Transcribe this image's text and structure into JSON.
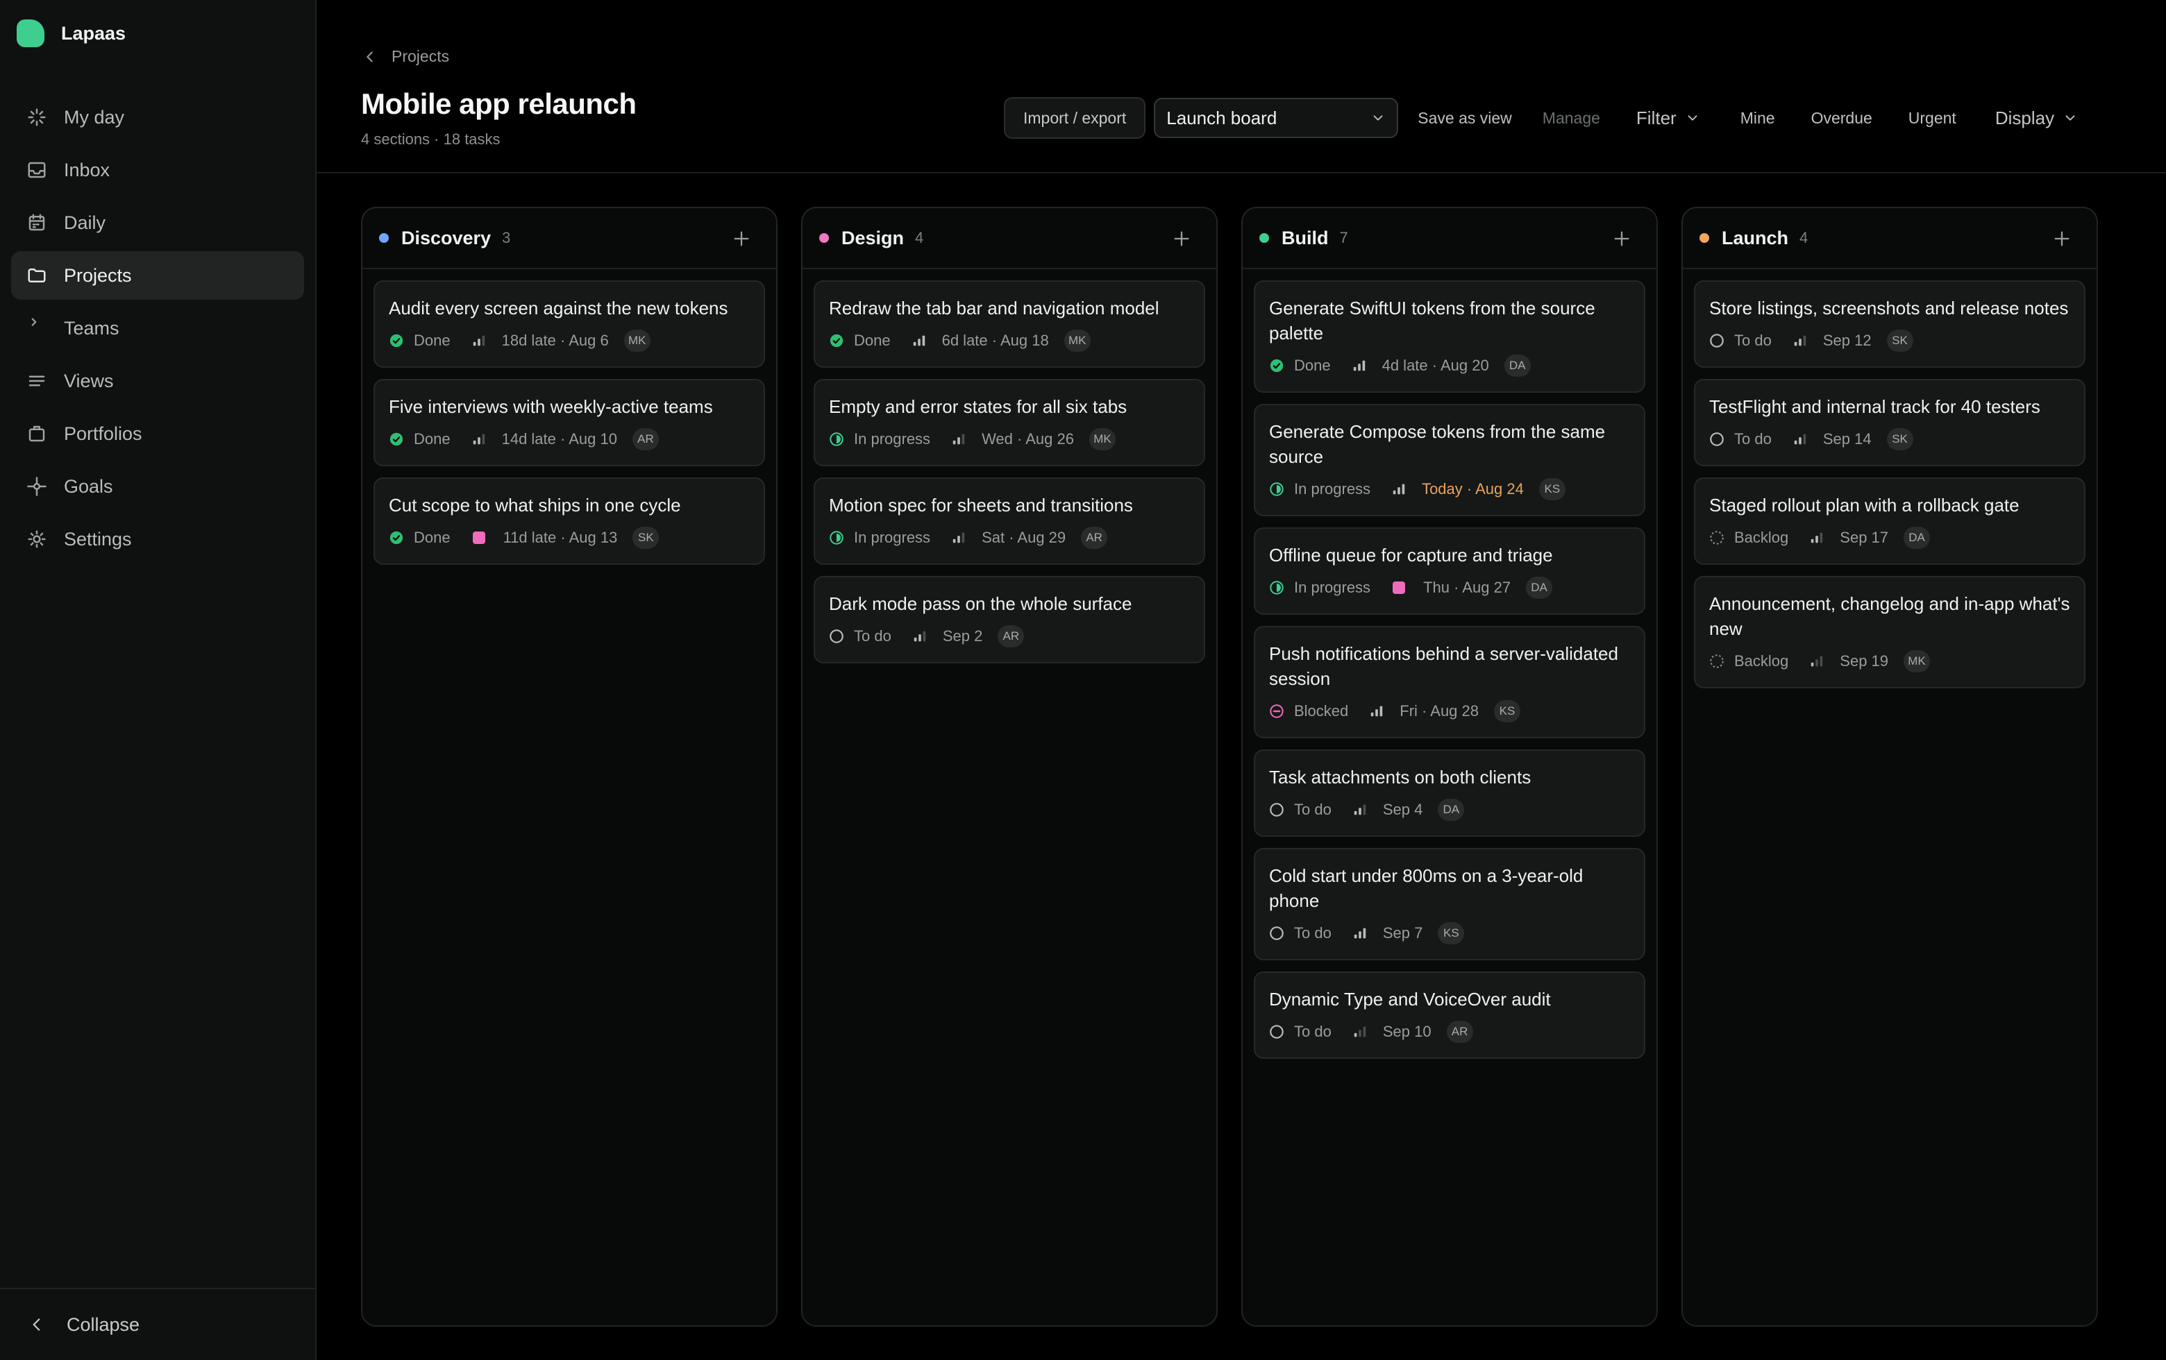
{
  "app": {
    "name": "Lapaas"
  },
  "sidebar": {
    "items": [
      {
        "label": "My day",
        "icon": "sparkle-icon",
        "active": false
      },
      {
        "label": "Inbox",
        "icon": "inbox-icon",
        "active": false
      },
      {
        "label": "Daily",
        "icon": "calendar-icon",
        "active": false
      },
      {
        "label": "Projects",
        "icon": "folder-icon",
        "active": true
      },
      {
        "label": "Teams",
        "icon": "chevron-right-icon",
        "active": false
      },
      {
        "label": "Views",
        "icon": "lines-icon",
        "active": false
      },
      {
        "label": "Portfolios",
        "icon": "briefcase-icon",
        "active": false
      },
      {
        "label": "Goals",
        "icon": "target-icon",
        "active": false
      },
      {
        "label": "Settings",
        "icon": "gear-icon",
        "active": false
      }
    ],
    "collapse_label": "Collapse"
  },
  "header": {
    "breadcrumb": "Projects",
    "title": "Mobile app relaunch",
    "subtitle": "4 sections · 18 tasks"
  },
  "toolbar": {
    "import_export": "Import / export",
    "view_select": "Launch board",
    "save_as_view": "Save as view",
    "manage": "Manage",
    "filter": "Filter",
    "mine": "Mine",
    "overdue": "Overdue",
    "urgent": "Urgent",
    "display": "Display"
  },
  "colors": {
    "discovery": "#6ea8fe",
    "design": "#f178c4",
    "build": "#3ecf8e",
    "launch": "#f2a65a",
    "done": "#2fbf71",
    "in_progress": "#3ecf8e",
    "blocked": "#f06bbd",
    "urgent": "#f06bbd",
    "today": "#e8a45c"
  },
  "columns": [
    {
      "title": "Discovery",
      "count": "3",
      "color": "#6ea8fe",
      "cards": [
        {
          "title": "Audit every screen against the new tokens",
          "status": "Done",
          "status_type": "done",
          "priority": "medium",
          "due": "18d late · Aug 6",
          "assignee": "MK"
        },
        {
          "title": "Five interviews with weekly-active teams",
          "status": "Done",
          "status_type": "done",
          "priority": "medium",
          "due": "14d late · Aug 10",
          "assignee": "AR"
        },
        {
          "title": "Cut scope to what ships in one cycle",
          "status": "Done",
          "status_type": "done",
          "priority": "urgent",
          "due": "11d late · Aug 13",
          "assignee": "SK"
        }
      ]
    },
    {
      "title": "Design",
      "count": "4",
      "color": "#f178c4",
      "cards": [
        {
          "title": "Redraw the tab bar and navigation model",
          "status": "Done",
          "status_type": "done",
          "priority": "high",
          "due": "6d late · Aug 18",
          "assignee": "MK"
        },
        {
          "title": "Empty and error states for all six tabs",
          "status": "In progress",
          "status_type": "progress",
          "priority": "medium",
          "due": "Wed · Aug 26",
          "assignee": "MK"
        },
        {
          "title": "Motion spec for sheets and transitions",
          "status": "In progress",
          "status_type": "progress",
          "priority": "medium",
          "due": "Sat · Aug 29",
          "assignee": "AR"
        },
        {
          "title": "Dark mode pass on the whole surface",
          "status": "To do",
          "status_type": "todo",
          "priority": "medium",
          "due": "Sep 2",
          "assignee": "AR"
        }
      ]
    },
    {
      "title": "Build",
      "count": "7",
      "color": "#3ecf8e",
      "cards": [
        {
          "title": "Generate SwiftUI tokens from the source palette",
          "status": "Done",
          "status_type": "done",
          "priority": "high",
          "due": "4d late · Aug 20",
          "assignee": "DA"
        },
        {
          "title": "Generate Compose tokens from the same source",
          "status": "In progress",
          "status_type": "progress",
          "priority": "high",
          "due": "Today · Aug 24",
          "due_today": true,
          "assignee": "KS"
        },
        {
          "title": "Offline queue for capture and triage",
          "status": "In progress",
          "status_type": "progress",
          "priority": "urgent",
          "due": "Thu · Aug 27",
          "assignee": "DA"
        },
        {
          "title": "Push notifications behind a server-validated session",
          "status": "Blocked",
          "status_type": "blocked",
          "priority": "high",
          "due": "Fri · Aug 28",
          "assignee": "KS"
        },
        {
          "title": "Task attachments on both clients",
          "status": "To do",
          "status_type": "todo",
          "priority": "medium",
          "due": "Sep 4",
          "assignee": "DA"
        },
        {
          "title": "Cold start under 800ms on a 3-year-old phone",
          "status": "To do",
          "status_type": "todo",
          "priority": "high",
          "due": "Sep 7",
          "assignee": "KS"
        },
        {
          "title": "Dynamic Type and VoiceOver audit",
          "status": "To do",
          "status_type": "todo",
          "priority": "low",
          "due": "Sep 10",
          "assignee": "AR"
        }
      ]
    },
    {
      "title": "Launch",
      "count": "4",
      "color": "#f2a65a",
      "cards": [
        {
          "title": "Store listings, screenshots and release notes",
          "status": "To do",
          "status_type": "todo",
          "priority": "medium",
          "due": "Sep 12",
          "assignee": "SK"
        },
        {
          "title": "TestFlight and internal track for 40 testers",
          "status": "To do",
          "status_type": "todo",
          "priority": "medium",
          "due": "Sep 14",
          "assignee": "SK"
        },
        {
          "title": "Staged rollout plan with a rollback gate",
          "status": "Backlog",
          "status_type": "backlog",
          "priority": "medium",
          "due": "Sep 17",
          "assignee": "DA"
        },
        {
          "title": "Announcement, changelog and in-app what's new",
          "status": "Backlog",
          "status_type": "backlog",
          "priority": "low",
          "due": "Sep 19",
          "assignee": "MK"
        }
      ]
    }
  ]
}
